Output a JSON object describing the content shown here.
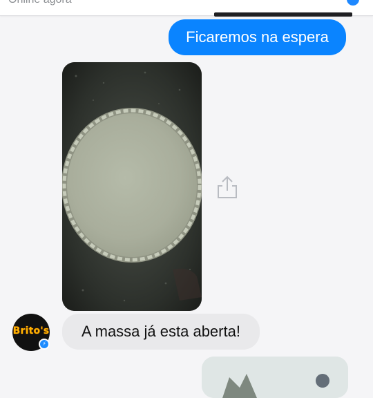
{
  "header": {
    "status": "Online agora"
  },
  "messages": {
    "outgoing_text": "Ficaremos na espera",
    "incoming_text": "A massa já esta aberta!"
  },
  "avatar": {
    "logo_text": "Brito's",
    "badge_icon": "messenger-icon"
  },
  "icons": {
    "share": "share-icon"
  },
  "colors": {
    "outgoing_bubble": "#0a84ff",
    "incoming_bubble": "#e9e9eb",
    "background": "#f5f5f7",
    "avatar_background": "#111111",
    "logo": "#ffb300"
  }
}
